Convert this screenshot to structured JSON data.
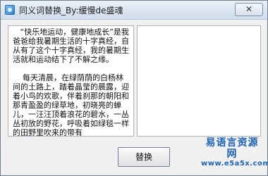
{
  "window": {
    "title": "同义词替换_By:缓慢de盛魂"
  },
  "titlebar": {
    "close_label": "✕"
  },
  "source_panel": {
    "text": "   “快乐地运动，健康地成长”是我爸爸给我暑期生活的十字真经，自从有了这个十字真经，我的暑期生活就和运动结下了不解之缘。\n\n    每天清晨，在绿荫荫的白杨林间的土路上，踏着晶莹的晨露，迎着小鸟的欢歌，伴着刹那的朝阳和那青盈盈的绿草地，初晓亮的蝉儿，一汪汪顶着浪花的碧水，一丛丛初放的野花，呼吸着如绿毯一样的田野里吹来的带有"
  },
  "result_panel": {
    "text": ""
  },
  "actions": {
    "replace_label": "替换"
  },
  "logo": {
    "name": "易语言资源网",
    "url": "www.e5a5x.com"
  }
}
